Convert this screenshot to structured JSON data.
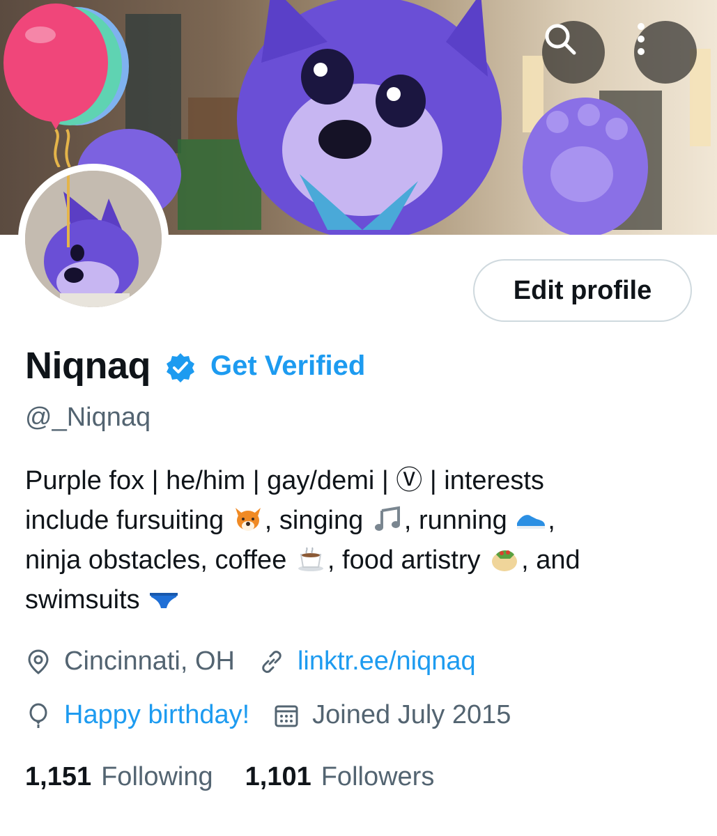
{
  "header": {
    "search_icon": "search-icon",
    "more_icon": "more-vertical-icon"
  },
  "profile": {
    "edit_label": "Edit profile",
    "display_name": "Niqnaq",
    "verified_icon": "verified-badge-icon",
    "get_verified_label": "Get Verified",
    "handle": "@_Niqnaq",
    "bio": {
      "line1": "Purple fox | he/him | gay/demi | Ⓥ | interests",
      "line2_a": "include fursuiting ",
      "line2_b": ", singing ",
      "line2_c": ", running ",
      "line2_d": ",",
      "line3_a": "ninja obstacles, coffee ",
      "line3_b": ", food artistry ",
      "line3_c": ", and",
      "line4_a": "swimsuits "
    },
    "location": "Cincinnati, OH",
    "website": "linktr.ee/niqnaq",
    "birthday": "Happy birthday!",
    "joined": "Joined July 2015"
  },
  "stats": {
    "following_count": "1,151",
    "following_label": "Following",
    "followers_count": "1,101",
    "followers_label": "Followers"
  },
  "colors": {
    "accent": "#1d9bf0",
    "text_primary": "#0f1419",
    "text_secondary": "#536471",
    "border": "#cfd9de"
  }
}
